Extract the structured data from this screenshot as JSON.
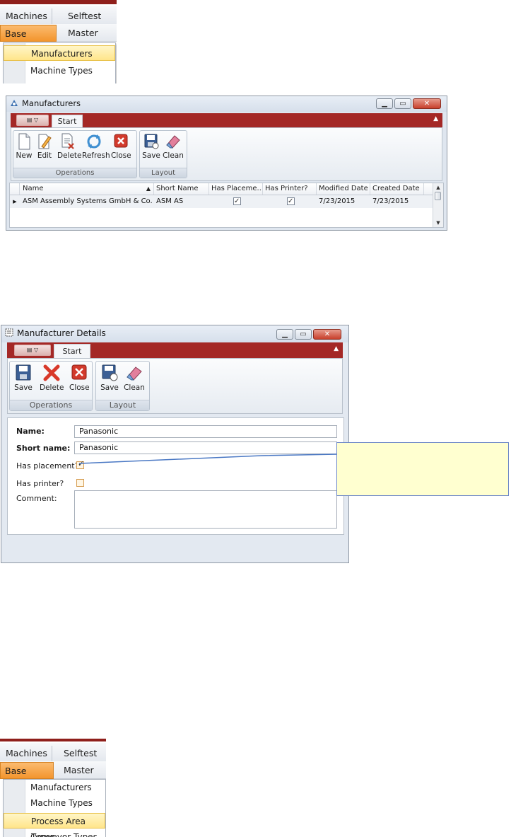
{
  "menu1": {
    "tabs": [
      "Machines",
      "Selftest"
    ],
    "base_data": "Base Data",
    "cut_tab": "Master Boar",
    "items": [
      "Manufacturers",
      "Machine Types"
    ]
  },
  "manufacturers_window": {
    "title": "Manufacturers",
    "tab": "Start",
    "ops_buttons": [
      "New",
      "Edit",
      "Delete",
      "Refresh",
      "Close"
    ],
    "ops_group": "Operations",
    "layout_buttons": [
      "Save",
      "Clean"
    ],
    "layout_group": "Layout",
    "columns": [
      "Name",
      "Short Name",
      "Has Placeme...",
      "Has Printer?",
      "Modified Date",
      "Created Date"
    ],
    "rows": [
      {
        "name": "ASM Assembly Systems GmbH & Co. KG",
        "short_name": "ASM AS",
        "has_placement": true,
        "has_printer": true,
        "modified": "7/23/2015",
        "created": "7/23/2015"
      }
    ]
  },
  "details_window": {
    "title": "Manufacturer Details",
    "tab": "Start",
    "ops_buttons": [
      "Save",
      "Delete",
      "Close"
    ],
    "ops_group": "Operations",
    "layout_buttons": [
      "Save",
      "Clean"
    ],
    "layout_group": "Layout",
    "labels": {
      "name": "Name:",
      "short_name": "Short name:",
      "has_placement": "Has placement?",
      "has_printer": "Has printer?",
      "comment": "Comment:"
    },
    "values": {
      "name": "Panasonic",
      "short_name": "Panasonic",
      "has_placement": true,
      "has_printer": false,
      "comment": ""
    }
  },
  "menu2": {
    "tabs": [
      "Machines",
      "Selftest"
    ],
    "base_data": "Base Data",
    "cut_tab": "Master Boar",
    "items": [
      "Manufacturers",
      "Machine Types",
      "Process Area Types",
      "Conveyor Types"
    ]
  }
}
